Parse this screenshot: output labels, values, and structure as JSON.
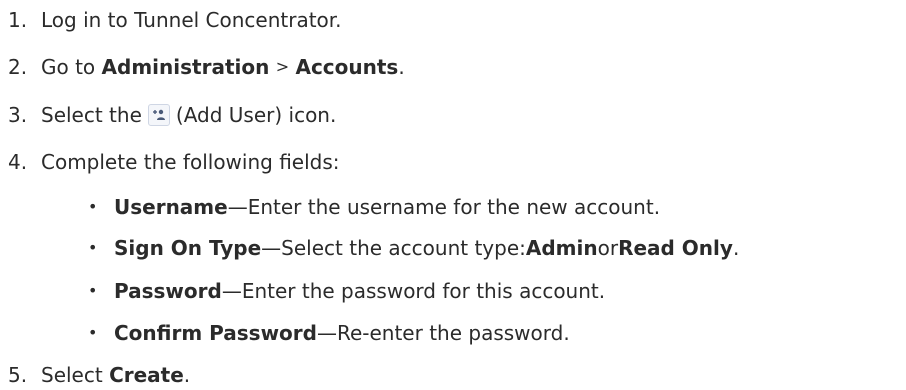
{
  "steps": [
    {
      "num": "1.",
      "text": "Log in to Tunnel Concentrator."
    },
    {
      "num": "2.",
      "pre": "Go to ",
      "b1": "Administration",
      "mid": " > ",
      "b2": "Accounts",
      "post": "."
    },
    {
      "num": "3.",
      "pre": "Select the ",
      "icon": "add-user-icon",
      "post": " (Add User) icon."
    },
    {
      "num": "4.",
      "text": "Complete the following fields:"
    },
    {
      "num": "5.",
      "pre": "Select ",
      "b1": "Create",
      "post": "."
    }
  ],
  "fields": [
    {
      "bullet": "•",
      "name": "Username",
      "desc": "—Enter the username for the new account."
    },
    {
      "bullet": "•",
      "name": "Sign On Type",
      "desc": "—Select the account type: ",
      "opt1": "Admin",
      "or": " or ",
      "opt2": "Read Only",
      "end": "."
    },
    {
      "bullet": "•",
      "name": "Password",
      "desc": "—Enter the password for this account."
    },
    {
      "bullet": "•",
      "name": "Confirm Password",
      "desc": "—Re-enter the password."
    }
  ]
}
